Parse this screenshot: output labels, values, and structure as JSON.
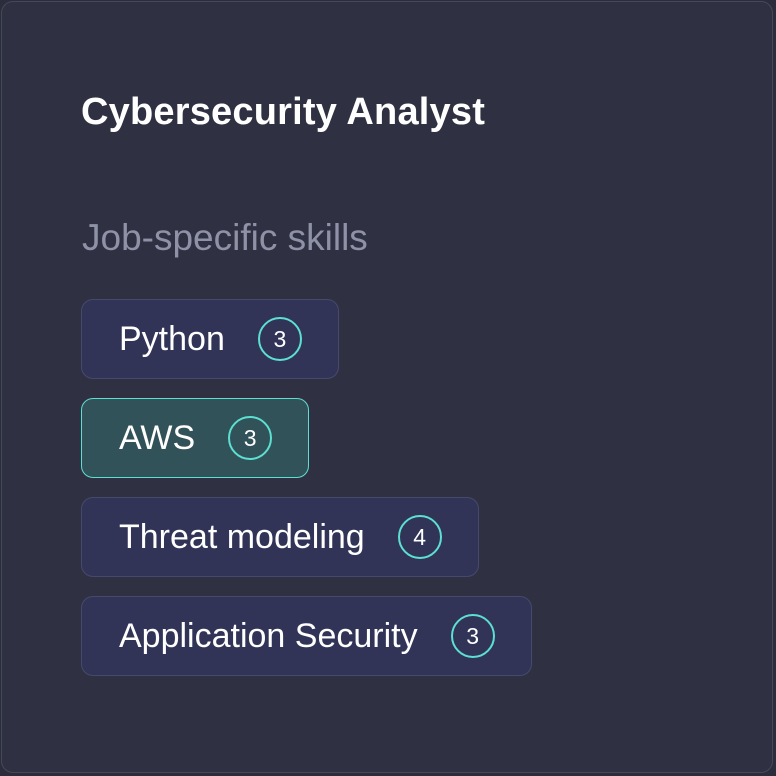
{
  "card": {
    "title": "Cybersecurity Analyst",
    "subtitle": "Job-specific skills"
  },
  "skills": [
    {
      "label": "Python",
      "count": "3",
      "selected": false
    },
    {
      "label": "AWS",
      "count": "3",
      "selected": true
    },
    {
      "label": "Threat modeling",
      "count": "4",
      "selected": false
    },
    {
      "label": "Application Security",
      "count": "3",
      "selected": false
    }
  ],
  "colors": {
    "background": "#2f3142",
    "chip_background": "#313457",
    "chip_selected_background": "#325259",
    "accent": "#5ce0d2",
    "subtitle": "#8f92a6"
  }
}
